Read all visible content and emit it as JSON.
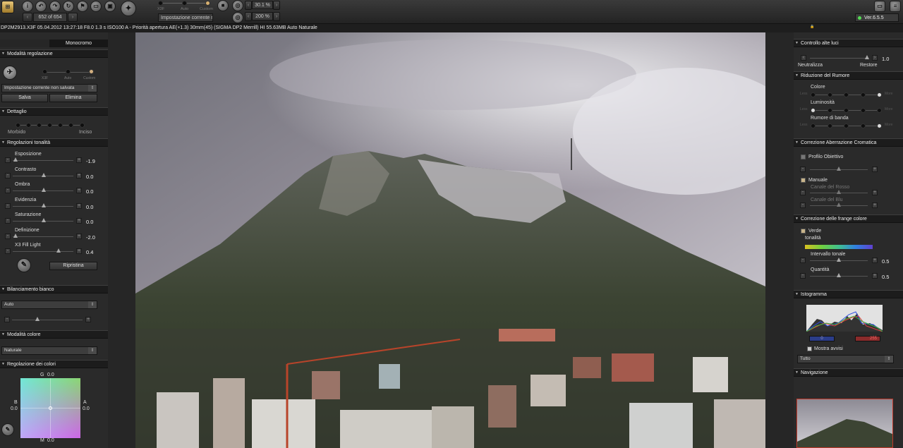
{
  "toolbar": {
    "counter": "652 of 654",
    "mode_labels": [
      "X3F",
      "Auto",
      "Custom"
    ],
    "preset": "Impostazione corrente no",
    "zoom": "30.1 %",
    "zoom2": "200 %",
    "version": "Ver.6.5.5"
  },
  "infobar": "DP2M2913.X3F 05.04.2012 13:27:18 F8.0 1.3 s ISO100 A - Priorità apertura AE(+1.3) 30mm(45) (SIGMA DP2 Merrill) HI 55.63MB Auto Naturale",
  "left": {
    "tab": "Monocromo",
    "mode": {
      "title": "Modalità regolazione",
      "labels": [
        "X3F",
        "Auto",
        "Custom"
      ],
      "preset": "Impostazione corrente non salvata",
      "save": "Salva",
      "delete": "Elimina"
    },
    "detail": {
      "title": "Dettaglio",
      "soft": "Morbido",
      "sharp": "Inciso"
    },
    "tone": {
      "title": "Regolazioni tonalità",
      "items": [
        {
          "label": "Esposizione",
          "value": "-1.9"
        },
        {
          "label": "Contrasto",
          "value": "0.0"
        },
        {
          "label": "Ombra",
          "value": "0.0"
        },
        {
          "label": "Evidenzia",
          "value": "0.0"
        },
        {
          "label": "Saturazione",
          "value": "0.0"
        },
        {
          "label": "Definizione",
          "value": "-2.0"
        },
        {
          "label": "X3 Fill Light",
          "value": "0.4"
        }
      ],
      "reset": "Ripristina"
    },
    "wb": {
      "title": "Bilanciamento bianco",
      "value": "Auto"
    },
    "color": {
      "title": "Modalità colore",
      "value": "Naturale"
    },
    "cadj": {
      "title": "Regolazione dei colori",
      "g": "G",
      "g_val": "0.0",
      "b": "B",
      "b_val": "0.0",
      "a": "A",
      "a_val": "0.0",
      "m": "M",
      "m_val": "0.0"
    }
  },
  "right": {
    "hl": {
      "title": "Controllo alte luci",
      "value": "1.0",
      "neutral": "Neutralizza",
      "restore": "Restore"
    },
    "nr": {
      "title": "Riduzione del Rumore",
      "color": "Colore",
      "lum": "Luminosità",
      "band": "Rumore di banda"
    },
    "ca": {
      "title": "Correzione Aberrazione Cromatica",
      "profile": "Profilo Obiettivo",
      "manual": "Manuale",
      "red": "Canale del Rosso",
      "blue": "Canale del Blu"
    },
    "fringe": {
      "title": "Correzione delle frange colore",
      "green": "Verde",
      "tone": "tonalità",
      "range": "Intervallo tonale",
      "range_val": "0.5",
      "amount": "Quantità",
      "amount_val": "0.5"
    },
    "hist": {
      "title": "Istogramma",
      "low": "0",
      "high": "255",
      "warn": "Mostra avvisi",
      "channel": "Tutto"
    },
    "nav": {
      "title": "Navigazione"
    }
  }
}
